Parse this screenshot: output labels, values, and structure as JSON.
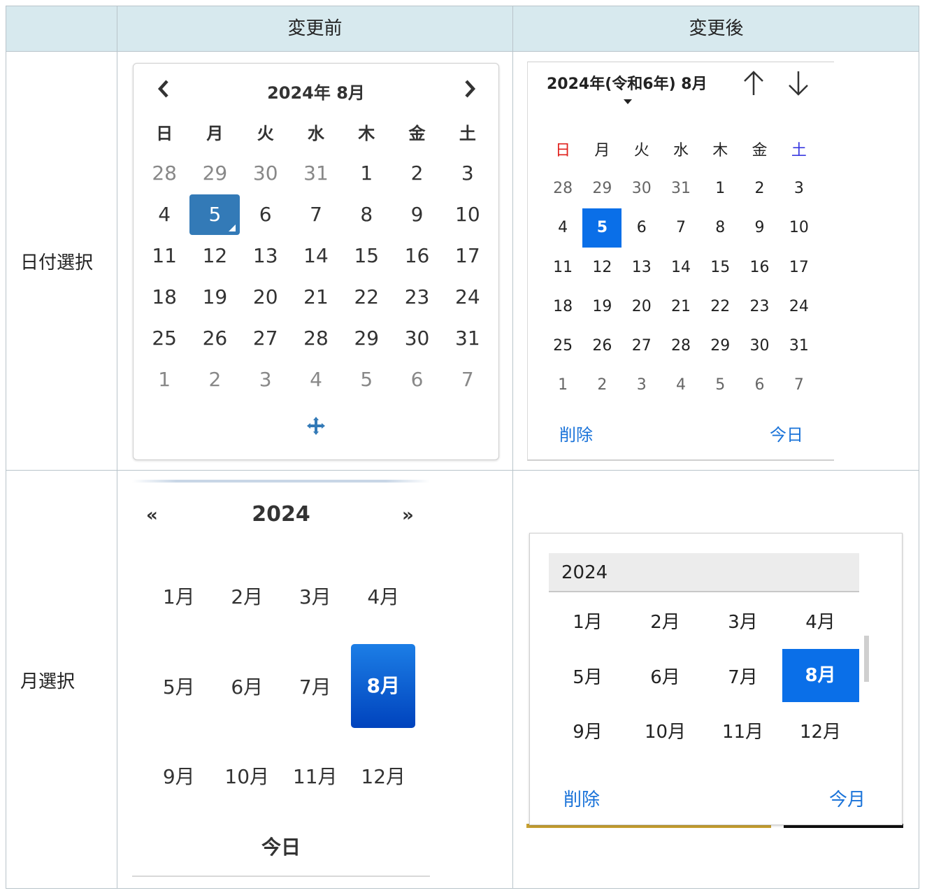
{
  "table": {
    "headers": [
      "",
      "変更前",
      "変更後"
    ],
    "rows": [
      "日付選択",
      "月選択"
    ]
  },
  "old_date_picker": {
    "title": "2024年 8月",
    "prev_icon": "chevron-left-icon",
    "next_icon": "chevron-right-icon",
    "weekdays": [
      "日",
      "月",
      "火",
      "水",
      "木",
      "金",
      "土"
    ],
    "weeks": [
      [
        "28",
        "29",
        "30",
        "31",
        "1",
        "2",
        "3"
      ],
      [
        "4",
        "5",
        "6",
        "7",
        "8",
        "9",
        "10"
      ],
      [
        "11",
        "12",
        "13",
        "14",
        "15",
        "16",
        "17"
      ],
      [
        "18",
        "19",
        "20",
        "21",
        "22",
        "23",
        "24"
      ],
      [
        "25",
        "26",
        "27",
        "28",
        "29",
        "30",
        "31"
      ],
      [
        "1",
        "2",
        "3",
        "4",
        "5",
        "6",
        "7"
      ]
    ],
    "selected": "5",
    "footer_icon": "move-crosshair-icon",
    "colors": {
      "selected_bg": "#337ab7",
      "icon": "#337ab7"
    }
  },
  "new_date_picker": {
    "title": "2024年(令和6年) 8月",
    "up_icon": "arrow-up-icon",
    "down_icon": "arrow-down-icon",
    "weekdays": [
      "日",
      "月",
      "火",
      "水",
      "木",
      "金",
      "土"
    ],
    "weeks": [
      [
        "28",
        "29",
        "30",
        "31",
        "1",
        "2",
        "3"
      ],
      [
        "4",
        "5",
        "6",
        "7",
        "8",
        "9",
        "10"
      ],
      [
        "11",
        "12",
        "13",
        "14",
        "15",
        "16",
        "17"
      ],
      [
        "18",
        "19",
        "20",
        "21",
        "22",
        "23",
        "24"
      ],
      [
        "25",
        "26",
        "27",
        "28",
        "29",
        "30",
        "31"
      ],
      [
        "1",
        "2",
        "3",
        "4",
        "5",
        "6",
        "7"
      ]
    ],
    "selected": "5",
    "clear_label": "削除",
    "today_label": "今日",
    "colors": {
      "sunday": "#e0201c",
      "saturday": "#3a3ae0",
      "selected_bg": "#0a6fe8",
      "link": "#1a73d9"
    }
  },
  "old_month_picker": {
    "prev_label": "«",
    "next_label": "»",
    "year": "2024",
    "months": [
      [
        "1月",
        "2月",
        "3月",
        "4月"
      ],
      [
        "5月",
        "6月",
        "7月",
        "8月"
      ],
      [
        "9月",
        "10月",
        "11月",
        "12月"
      ]
    ],
    "selected": "8月",
    "today_label": "今日"
  },
  "new_month_picker": {
    "year": "2024",
    "months": [
      [
        "1月",
        "2月",
        "3月",
        "4月"
      ],
      [
        "5月",
        "6月",
        "7月",
        "8月"
      ],
      [
        "9月",
        "10月",
        "11月",
        "12月"
      ]
    ],
    "selected": "8月",
    "clear_label": "削除",
    "this_month_label": "今月"
  }
}
